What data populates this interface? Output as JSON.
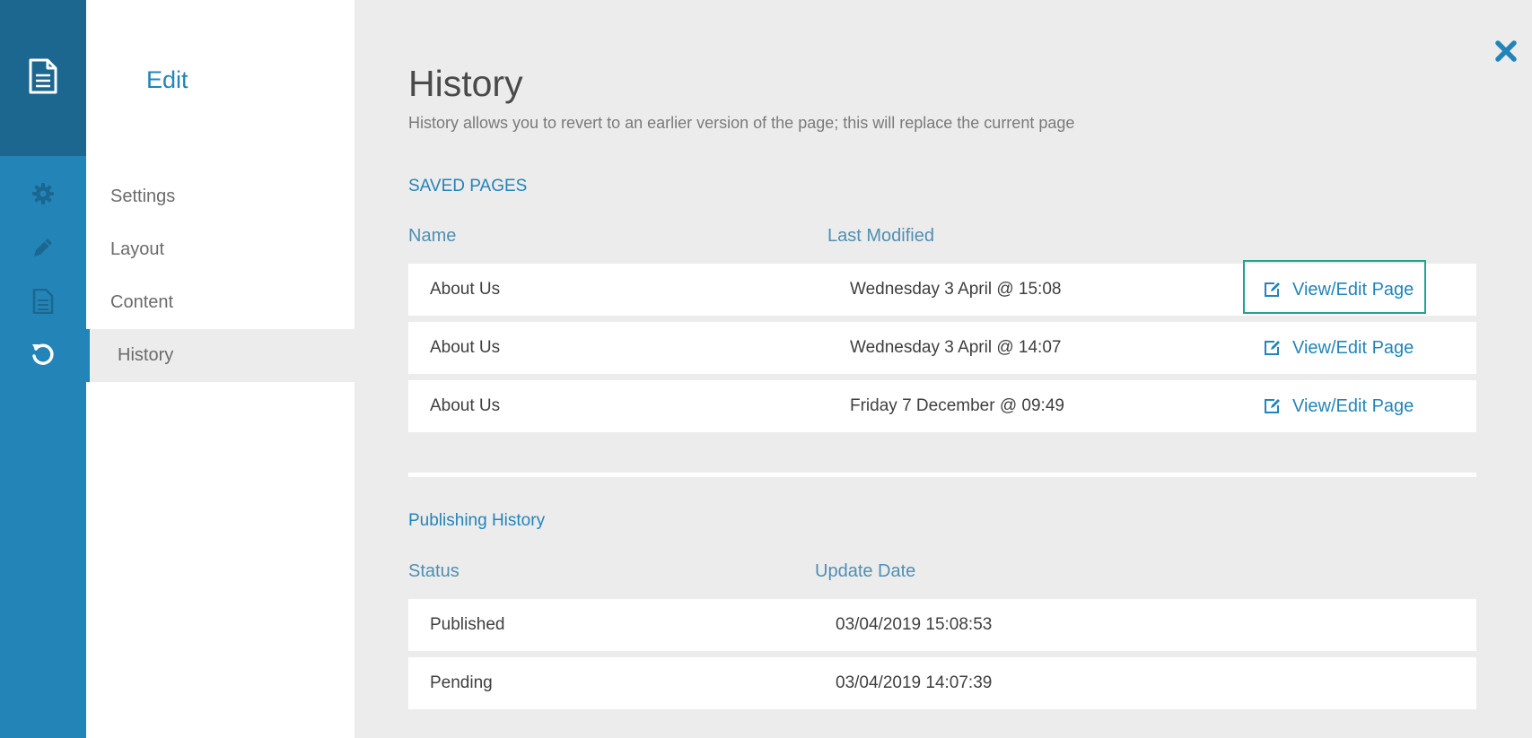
{
  "rail": {
    "icons": [
      "document-icon",
      "gear-icon",
      "pencil-icon",
      "page-icon",
      "history-icon"
    ]
  },
  "subnav": {
    "title": "Edit",
    "items": [
      {
        "label": "Settings",
        "active": false
      },
      {
        "label": "Layout",
        "active": false
      },
      {
        "label": "Content",
        "active": false
      },
      {
        "label": "History",
        "active": true
      }
    ]
  },
  "main": {
    "title": "History",
    "subtitle": "History allows you to revert to an earlier version of the page; this will replace the current page",
    "close_icon": "close-icon",
    "saved": {
      "title": "SAVED PAGES",
      "columns": [
        "Name",
        "Last Modified"
      ],
      "rows": [
        {
          "name": "About Us",
          "modified": "Wednesday 3 April @ 15:08",
          "action": "View/Edit Page"
        },
        {
          "name": "About Us",
          "modified": "Wednesday 3 April @ 14:07",
          "action": "View/Edit Page"
        },
        {
          "name": "About Us",
          "modified": "Friday 7 December @ 09:49",
          "action": "View/Edit Page"
        }
      ]
    },
    "publishing": {
      "title": "Publishing History",
      "columns": [
        "Status",
        "Update Date"
      ],
      "rows": [
        {
          "status": "Published",
          "date": "03/04/2019 15:08:53"
        },
        {
          "status": "Pending",
          "date": "03/04/2019 14:07:39"
        }
      ]
    }
  },
  "colors": {
    "accent": "#2384b8",
    "rail_dark": "#1b6790",
    "highlight": "#21a48e"
  }
}
